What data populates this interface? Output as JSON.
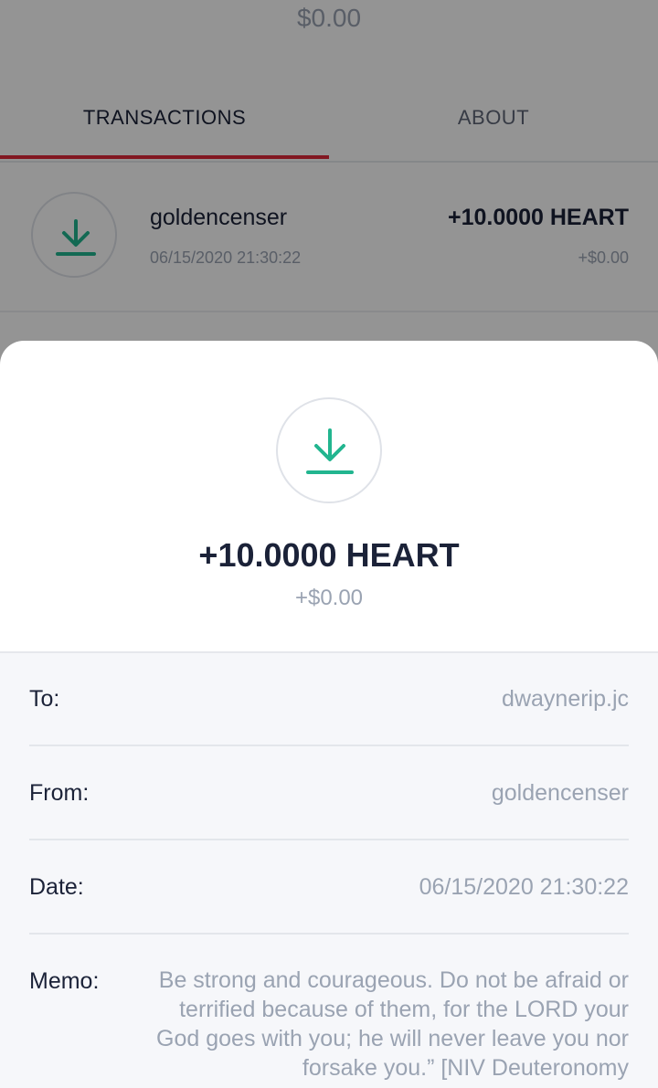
{
  "balance": "$0.00",
  "tabs": [
    {
      "label": "TRANSACTIONS",
      "active": true
    },
    {
      "label": "ABOUT",
      "active": false
    }
  ],
  "transactions": [
    {
      "icon": "download-icon",
      "name": "goldencenser",
      "date": "06/15/2020 21:30:22",
      "amount": "+10.0000 HEART",
      "usd": "+$0.00"
    }
  ],
  "detail": {
    "icon": "download-icon",
    "amount": "+10.0000 HEART",
    "usd": "+$0.00",
    "to_label": "To:",
    "to_value": "dwaynerip.jc",
    "from_label": "From:",
    "from_value": "goldencenser",
    "date_label": "Date:",
    "date_value": "06/15/2020 21:30:22",
    "memo_label": "Memo:",
    "memo_value": "Be strong and courageous. Do not be afraid or terrified because of them, for the LORD your God goes with you; he will never leave you nor forsake you.” [NIV Deuteronomy"
  },
  "colors": {
    "accent": "#e0283a",
    "icon_green": "#22b58f",
    "text_dark": "#1b2238",
    "text_muted": "#9aa3b2"
  }
}
